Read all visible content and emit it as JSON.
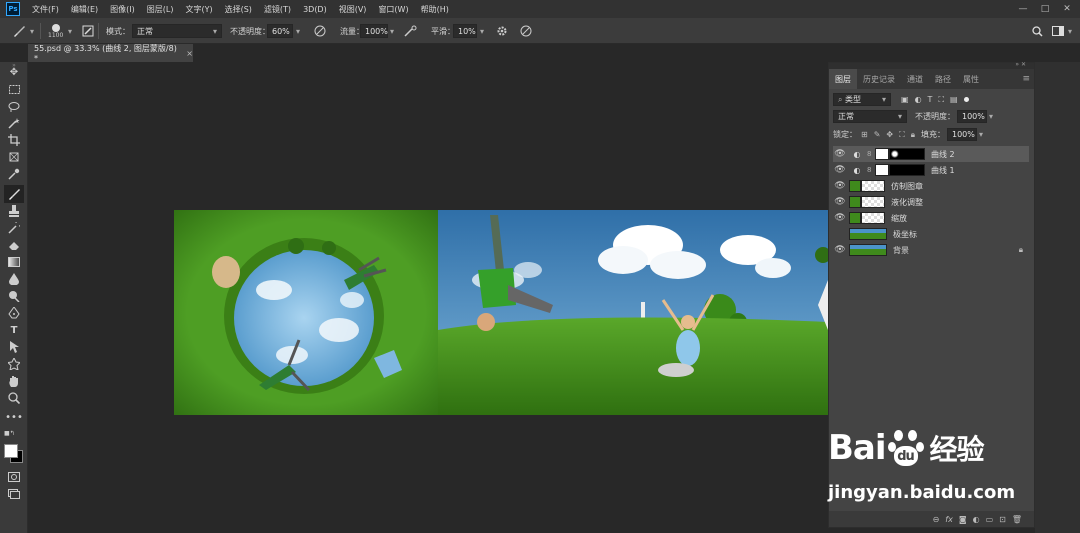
{
  "app": {
    "logo": "Ps"
  },
  "menu": [
    "文件(F)",
    "编辑(E)",
    "图像(I)",
    "图层(L)",
    "文字(Y)",
    "选择(S)",
    "滤镜(T)",
    "3D(D)",
    "视图(V)",
    "窗口(W)",
    "帮助(H)"
  ],
  "window_controls": {
    "minimize": "—",
    "maximize": "□",
    "close": "✕"
  },
  "options": {
    "brush_size": "1100",
    "mode_label": "模式：",
    "mode_value": "正常",
    "opacity_label": "不透明度：",
    "opacity_value": "60%",
    "flow_label": "流量：",
    "flow_value": "100%",
    "smooth_label": "平滑：",
    "smooth_value": "10%"
  },
  "document_tab": {
    "title": "55.psd @ 33.3% (曲线 2, 图层蒙版/8) *",
    "close": "×"
  },
  "layers_panel": {
    "tabs": [
      "图层",
      "历史记录",
      "通道",
      "路径",
      "属性"
    ],
    "filter_label": "类型",
    "blend_mode": "正常",
    "opacity_label": "不透明度：",
    "opacity_value": "100%",
    "lock_label": "锁定：",
    "fill_label": "填充：",
    "fill_value": "100%",
    "layers": [
      {
        "name": "曲线 2",
        "kind": "adjust",
        "selected": true,
        "visible": true
      },
      {
        "name": "曲线 1",
        "kind": "adjust",
        "selected": false,
        "visible": true
      },
      {
        "name": "仿制图章",
        "kind": "pixel",
        "selected": false,
        "visible": true
      },
      {
        "name": "液化调整",
        "kind": "pixel",
        "selected": false,
        "visible": true
      },
      {
        "name": "缩放",
        "kind": "pixel",
        "selected": false,
        "visible": true
      },
      {
        "name": "极坐标",
        "kind": "image",
        "selected": false,
        "visible": false
      },
      {
        "name": "背景",
        "kind": "image",
        "selected": false,
        "visible": true,
        "locked": true
      }
    ]
  },
  "watermark": {
    "brand": "Bai",
    "brand2": "du",
    "suffix": "经验",
    "url": "jingyan.baidu.com"
  },
  "colors": {
    "accent": "#31a8ff",
    "grass": "#3f8a1c",
    "sky": "#3f8fc2"
  }
}
